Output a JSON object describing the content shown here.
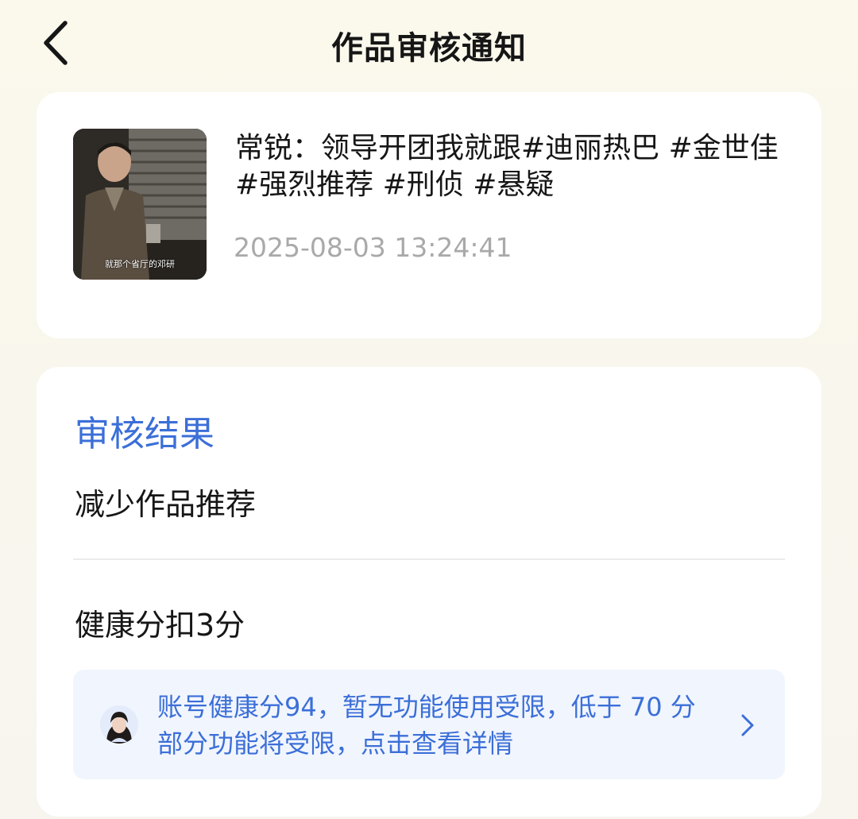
{
  "header": {
    "title": "作品审核通知",
    "back_icon": "chevron-left-icon"
  },
  "video": {
    "title": "常锐：领导开团我就跟#迪丽热巴 #金世佳 #强烈推荐 #刑侦 #悬疑",
    "time": "2025-08-03 13:24:41",
    "thumbnail_caption": "就那个省厅的邓研"
  },
  "result": {
    "section_title": "审核结果",
    "outcome": "减少作品推荐",
    "deduction": "健康分扣3分",
    "notice": {
      "text": "账号健康分94，暂无功能使用受限，低于 70 分部分功能将受限，点击查看详情",
      "icon": "chevron-right-icon"
    }
  },
  "colors": {
    "accent": "#3b6fd8",
    "notice_bg": "#f1f5fd",
    "time_gray": "#a9a9a9",
    "page_bg": "#faf7ee"
  }
}
